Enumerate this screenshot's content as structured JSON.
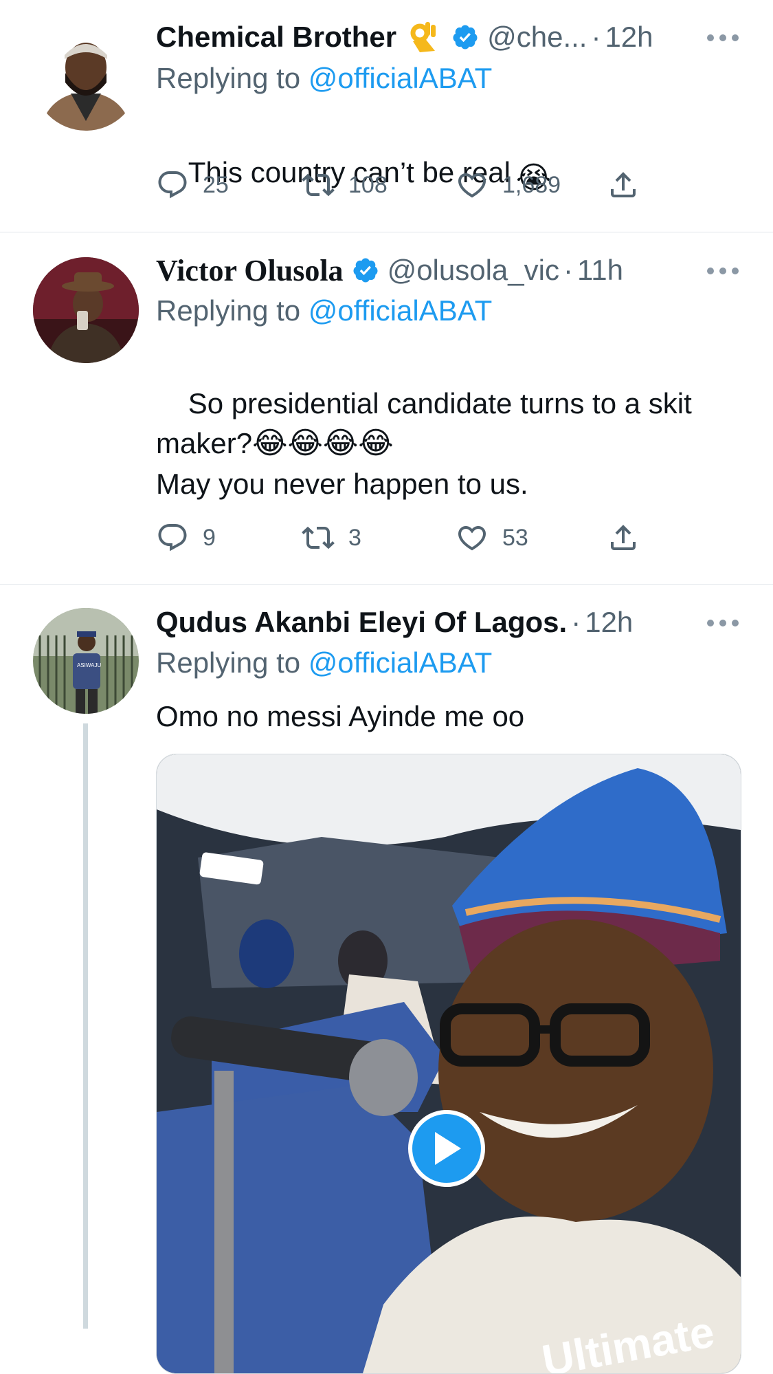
{
  "tweets": [
    {
      "name": "Chemical Brother",
      "name_emoji": "👌",
      "handle": "@che...",
      "time": "12h",
      "replying_prefix": "Replying to",
      "replying_to": "@officialABAT",
      "text": "This country can’t be real",
      "text_emoji": "😭",
      "replies": "25",
      "retweets": "108",
      "likes": "1,689"
    },
    {
      "name": "Victor Olusola",
      "handle": "@olusola_vic",
      "time": "11h",
      "replying_prefix": "Replying to",
      "replying_to": "@officialABAT",
      "text": "So presidential candidate turns to a skit maker?",
      "text_emoji": "😂😂😂😂",
      "text2": "May you never happen to us.",
      "replies": "9",
      "retweets": "3",
      "likes": "53"
    },
    {
      "name": "Qudus Akanbi Eleyi Of Lagos.",
      "time": "12h",
      "replying_prefix": "Replying to",
      "replying_to": "@officialABAT",
      "text": "Omo no messi Ayinde me oo",
      "media_watermark": "Ultimate",
      "shirt_text": "ASIWAJU"
    }
  ],
  "colors": {
    "link": "#1d9bf0",
    "secondary": "#536471",
    "verified": "#1d9bf0",
    "divider": "#e1e6ea"
  },
  "icons": [
    "reply-icon",
    "retweet-icon",
    "like-icon",
    "share-icon",
    "verified-badge-icon",
    "more-icon",
    "play-icon"
  ]
}
